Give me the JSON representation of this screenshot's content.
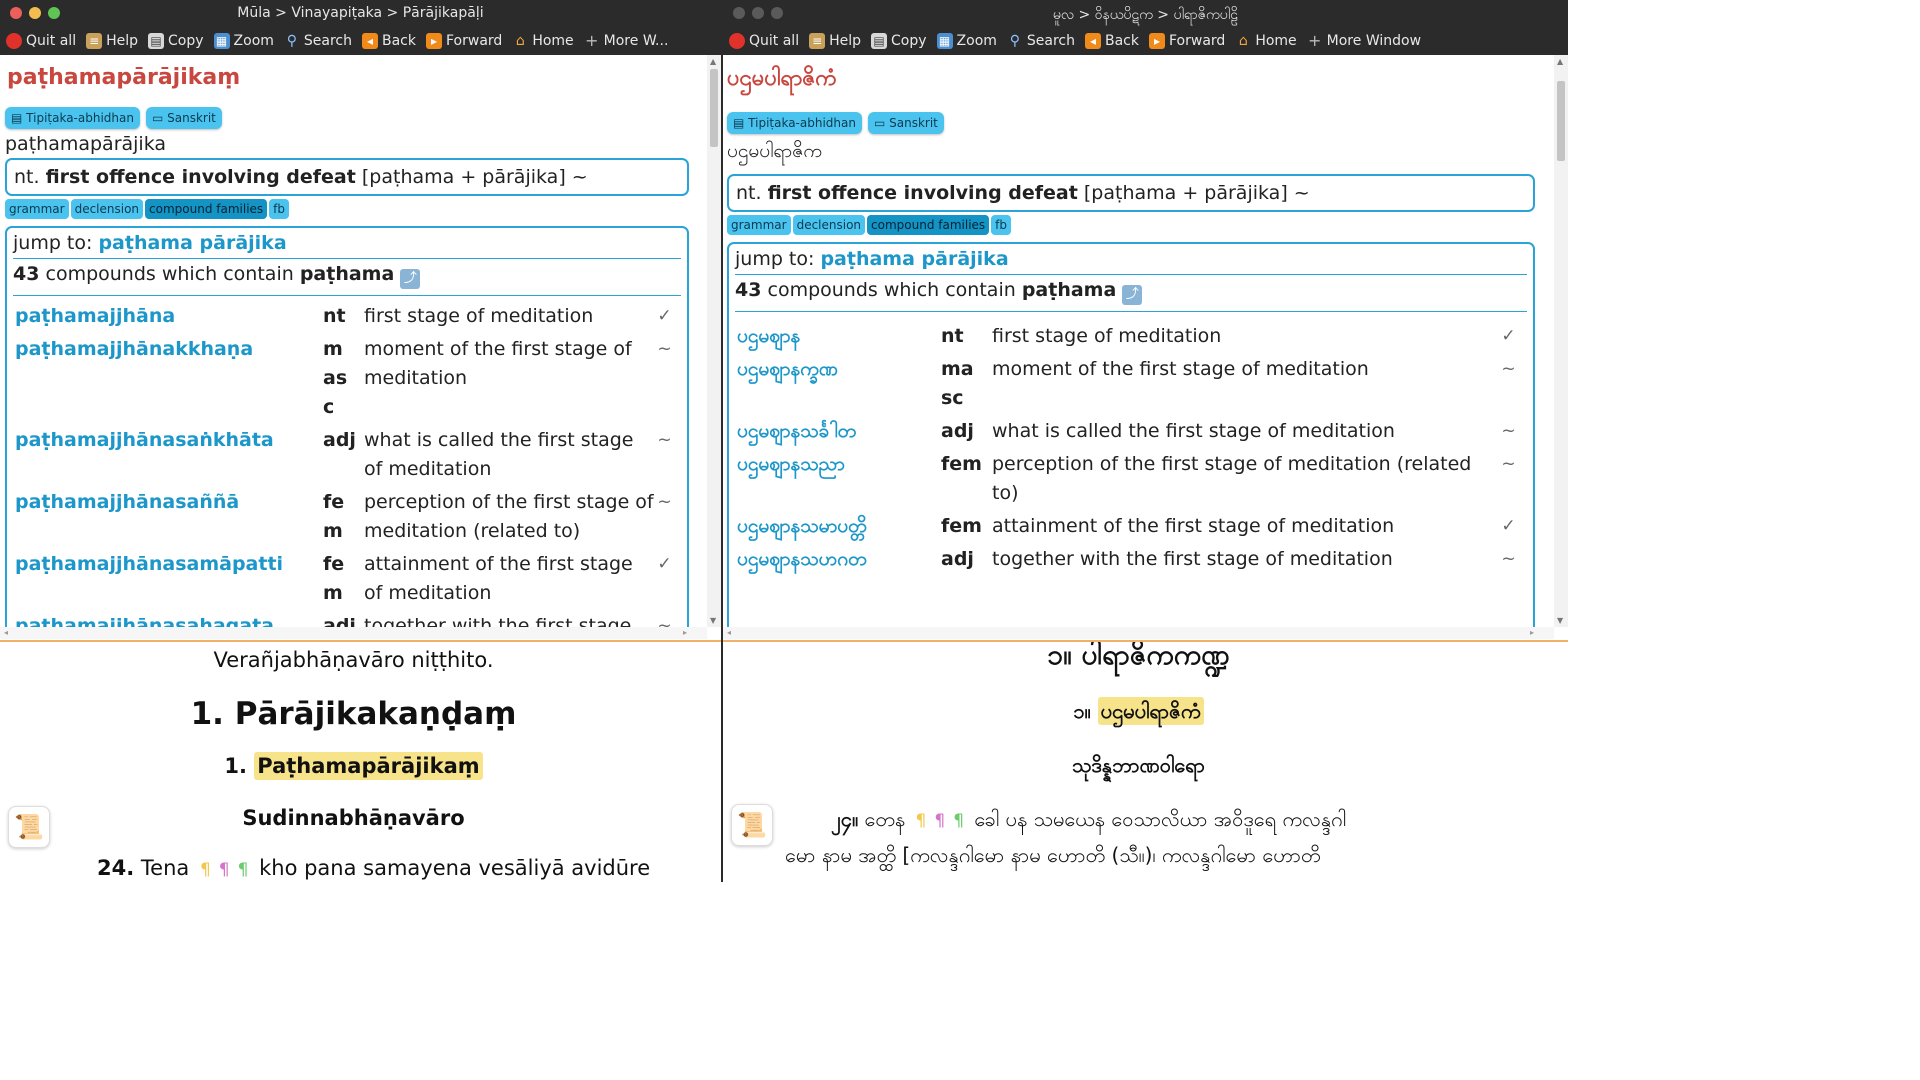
{
  "left": {
    "title": "Mūla > Vinayapiṭaka > Pārājikapāḷi",
    "toolbar": [
      "Quit all",
      "Help",
      "Copy",
      "Zoom",
      "Search",
      "Back",
      "Forward",
      "Home",
      "More W..."
    ],
    "headword": "paṭhamapārājikaṃ",
    "tags": [
      "Tipiṭaka-abhidhan",
      "Sanskrit"
    ],
    "lemma": "paṭhamapārājika",
    "def": {
      "pos": "nt.",
      "meaning": "first offence involving defeat",
      "construction": "[paṭhama + pārājika] ~"
    },
    "buttons": [
      "grammar",
      "declension",
      "compound families",
      "fb"
    ],
    "jump_label": "jump to:",
    "jump_links": "paṭhama pārājika",
    "count": "43",
    "count_text": "compounds which contain",
    "count_word": "paṭhama",
    "rows": [
      {
        "word": "paṭhamajjhāna",
        "pos": "nt",
        "meaning": "first stage of meditation",
        "mark": "✓"
      },
      {
        "word": "paṭhamajjhānakkhaṇa",
        "pos": "m\nas\nc",
        "meaning": "moment of the first stage of meditation",
        "mark": "~"
      },
      {
        "word": "paṭhamajjhānasaṅkhāta",
        "pos": "adj",
        "meaning": "what is called the first stage of meditation",
        "mark": "~"
      },
      {
        "word": "paṭhamajjhānasaññā",
        "pos": "fe\nm",
        "meaning": "perception of the first stage of meditation (related to)",
        "mark": "~"
      },
      {
        "word": "paṭhamajjhānasamāpatti",
        "pos": "fe\nm",
        "meaning": "attainment of the first stage of meditation",
        "mark": "✓"
      },
      {
        "word": "paṭhamajjhānasahagata",
        "pos": "adj",
        "meaning": "together with the first stage of",
        "mark": "~"
      }
    ],
    "text": {
      "line1": "Verañjabhāṇavāro niṭṭhito.",
      "heading_num": "1.",
      "heading": "Pārājikakaṇḍaṃ",
      "sub_num": "1.",
      "sub": "Paṭhamapārājikaṃ",
      "section": "Sudinnabhāṇavāro",
      "para_num": "24.",
      "para_start": "Tena",
      "para_rest": "kho pana samayena vesāliyā avidūre"
    }
  },
  "right": {
    "title": "မူလ > ဝိနယပိဋက > ပါရာဇိကပါဠိ",
    "toolbar": [
      "Quit all",
      "Help",
      "Copy",
      "Zoom",
      "Search",
      "Back",
      "Forward",
      "Home",
      "More Window"
    ],
    "headword": "ပဌမပါရာဇိကံ",
    "tags": [
      "Tipiṭaka-abhidhan",
      "Sanskrit"
    ],
    "lemma": "ပဌမပါရာဇိက",
    "def": {
      "pos": "nt.",
      "meaning": "first offence involving defeat",
      "construction": "[paṭhama + pārājika] ~"
    },
    "buttons": [
      "grammar",
      "declension",
      "compound families",
      "fb"
    ],
    "jump_label": "jump to:",
    "jump_links": "paṭhama pārājika",
    "count": "43",
    "count_text": "compounds which contain",
    "count_word": "paṭhama",
    "rows": [
      {
        "word": "ပဌမဈာန",
        "pos": "nt",
        "meaning": "first stage of meditation",
        "mark": "✓"
      },
      {
        "word": "ပဌမဈာနက္ခဏ",
        "pos": "ma\nsc",
        "meaning": "moment of the first stage of meditation",
        "mark": "~"
      },
      {
        "word": "ပဌမဈာနသင်္ခါတ",
        "pos": "adj",
        "meaning": "what is called the first stage of meditation",
        "mark": "~"
      },
      {
        "word": "ပဌမဈာနသညာ",
        "pos": "fem",
        "meaning": "perception of the first stage of meditation (related to)",
        "mark": "~"
      },
      {
        "word": "ပဌမဈာနသမာပတ္တိ",
        "pos": "fem",
        "meaning": "attainment of the first stage of meditation",
        "mark": "✓"
      },
      {
        "word": "ပဌမဈာနသဟဂတ",
        "pos": "adj",
        "meaning": "together with the first stage of meditation",
        "mark": "~"
      }
    ],
    "text": {
      "heading": "၁။ ပါရာဇိကကဏ္ဍ",
      "sub_num": "၁။",
      "sub": "ပဌမပါရာဇိကံ",
      "section": "သုဒိန္နဘာဏဝါရော",
      "para_num": "၂၄။",
      "para_start": "တေန",
      "para_rest": "ခေါ ပန သမယေန ဝေသာလိယာ အဝိဒူရေ ကလန္ဒဂါ",
      "line2": "မော နာမ အတ္ထိ [ကလန္ဒဂါမော နာမ ဟောတိ (သီ။)၊ ကလန္ဒဂါမော ဟောတိ"
    }
  }
}
